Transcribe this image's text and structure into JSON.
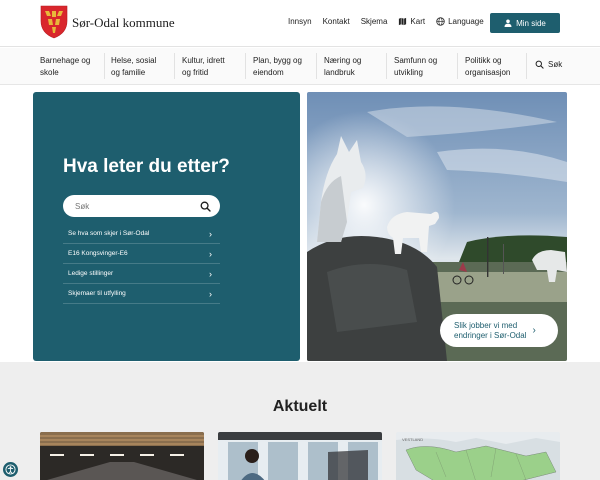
{
  "header": {
    "site_name": "Sør-Odal kommune",
    "links": {
      "innsyn": "Innsyn",
      "kontakt": "Kontakt",
      "skjema": "Skjema",
      "kart": "Kart",
      "language": "Language"
    },
    "min_side": "Min side"
  },
  "nav": {
    "items": [
      {
        "line1": "Barnehage og",
        "line2": "skole"
      },
      {
        "line1": "Helse, sosial",
        "line2": "og familie"
      },
      {
        "line1": "Kultur, idrett",
        "line2": "og fritid"
      },
      {
        "line1": "Plan, bygg og",
        "line2": "eiendom"
      },
      {
        "line1": "Næring og",
        "line2": "landbruk"
      },
      {
        "line1": "Samfunn og",
        "line2": "utvikling"
      },
      {
        "line1": "Politikk og",
        "line2": "organisasjon"
      }
    ],
    "search": "Søk"
  },
  "hero": {
    "title": "Hva leter du etter?",
    "search_placeholder": "Søk",
    "quick_links": [
      "Se hva som skjer i Sør-Odal",
      "E16 Kongsvinger-E6",
      "Ledige stillinger",
      "Skjemaer til utfylling"
    ],
    "cta_line1": "Slik jobber vi med",
    "cta_line2": "endringer i Sør-Odal"
  },
  "news": {
    "title": "Aktuelt"
  },
  "colors": {
    "brand": "#1e5e6e",
    "news_bg": "#eeeeee",
    "logo_red": "#d9262c",
    "logo_gold": "#e8b93a"
  },
  "icons": [
    "coat-of-arms",
    "map-icon",
    "globe-icon",
    "user-icon",
    "search-icon",
    "chevron-right-icon",
    "accessibility-icon"
  ]
}
